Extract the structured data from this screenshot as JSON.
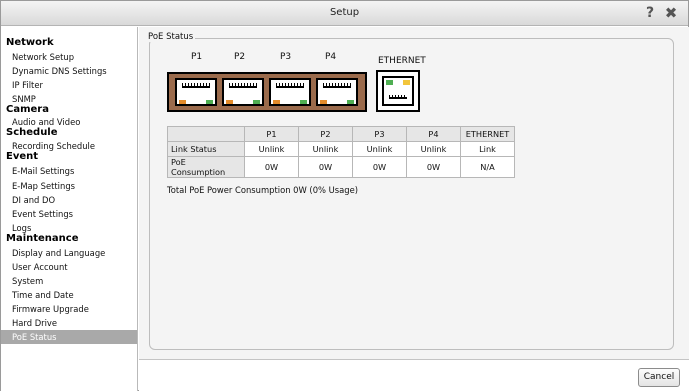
{
  "window": {
    "title": "Setup",
    "help_icon": "question-icon",
    "close_icon": "close-icon"
  },
  "sidebar": {
    "sections": [
      {
        "label": "Network",
        "items": [
          "Network Setup",
          "Dynamic DNS Settings",
          "IP Filter",
          "SNMP"
        ]
      },
      {
        "label": "Camera",
        "items": [
          "Audio and Video"
        ]
      },
      {
        "label": "Schedule",
        "items": [
          "Recording Schedule"
        ]
      },
      {
        "label": "Event",
        "items": [
          "E-Mail Settings",
          "E-Map Settings",
          "DI and DO",
          "Event Settings",
          "Logs"
        ]
      },
      {
        "label": "Maintenance",
        "items": [
          "Display and Language",
          "User Account",
          "System",
          "Time and Date",
          "Firmware Upgrade",
          "Hard Drive",
          "PoE Status"
        ]
      }
    ],
    "active_item": "PoE Status"
  },
  "poe": {
    "legend": "PoE Status",
    "port_labels": [
      "P1",
      "P2",
      "P3",
      "P4"
    ],
    "ethernet_label": "ETHERNET",
    "table": {
      "headers": [
        "",
        "P1",
        "P2",
        "P3",
        "P4",
        "ETHERNET"
      ],
      "rows": [
        {
          "label": "Link Status",
          "values": [
            "Unlink",
            "Unlink",
            "Unlink",
            "Unlink",
            "Link"
          ]
        },
        {
          "label": "PoE Consumption",
          "values": [
            "0W",
            "0W",
            "0W",
            "0W",
            "N/A"
          ]
        }
      ]
    },
    "total_text": "Total PoE Power Consumption 0W (0% Usage)"
  },
  "footer": {
    "cancel_label": "Cancel"
  },
  "colors": {
    "active_bg": "#a9a9a9",
    "port_block": "#9b6b4c",
    "led_orange": "#e38b2a",
    "led_green": "#4fae52",
    "led_yellow": "#f2c53c"
  }
}
